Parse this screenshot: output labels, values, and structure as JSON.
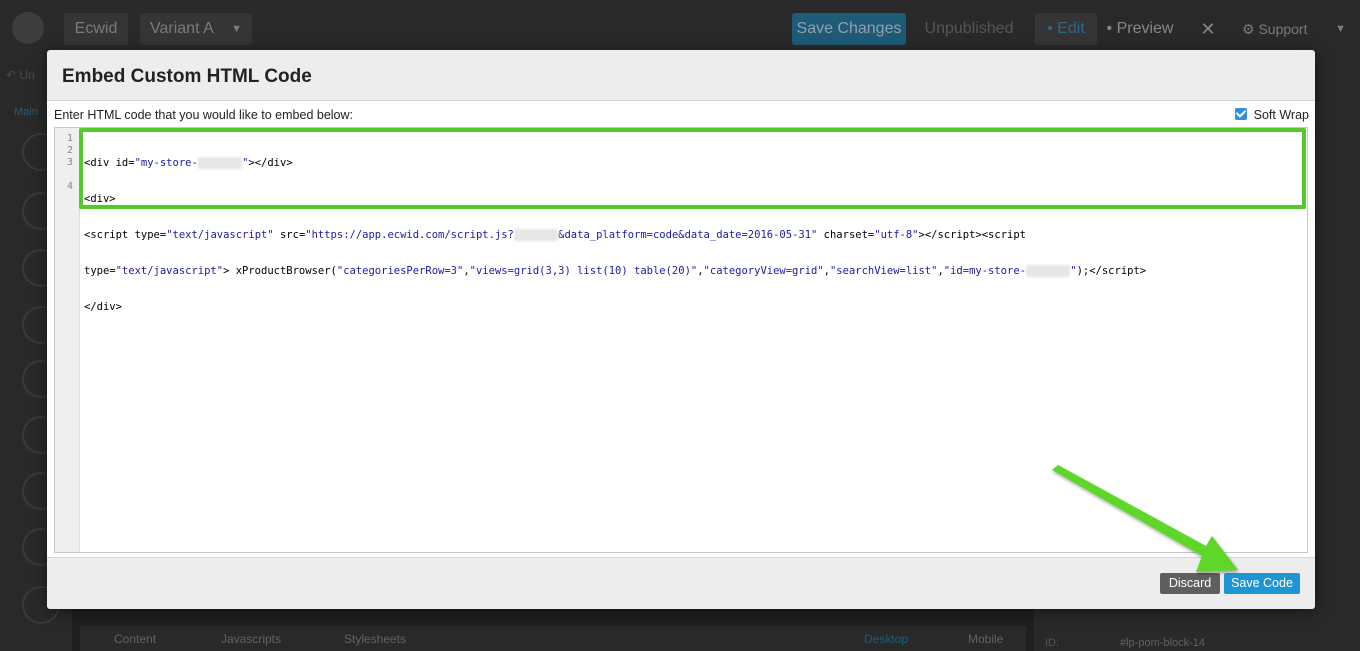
{
  "app": {
    "brand": "Ecwid",
    "variant": "Variant A",
    "save_changes": "Save Changes",
    "unpublished": "Unpublished",
    "edit": "Edit",
    "preview": "Preview",
    "close": "✕",
    "support": "Support",
    "undo": "Un",
    "main_tab": "Main"
  },
  "bottombar": {
    "content": "Content",
    "javascripts": "Javascripts",
    "stylesheets": "Stylesheets",
    "desktop": "Desktop",
    "mobile": "Mobile"
  },
  "rightpanel": {
    "id_label": "ID:",
    "id_value": "#lp-pom-block-14"
  },
  "modal": {
    "title": "Embed Custom HTML Code",
    "instruction": "Enter HTML code that you would like to embed below:",
    "soft_wrap_label": "Soft Wrap",
    "soft_wrap_checked": true,
    "line_numbers": [
      "1",
      "2",
      "3",
      "",
      "4"
    ],
    "discard_label": "Discard",
    "save_code_label": "Save Code"
  },
  "colors": {
    "highlight": "#56c82a",
    "primary_button": "#1e96d6",
    "secondary_button": "#5f5f5f",
    "arrow": "#5fd62a"
  },
  "icons": [
    "undo-icon",
    "chevron-down-icon",
    "close-icon",
    "support-icon",
    "checkbox-icon",
    "arrow-annotation-icon"
  ]
}
